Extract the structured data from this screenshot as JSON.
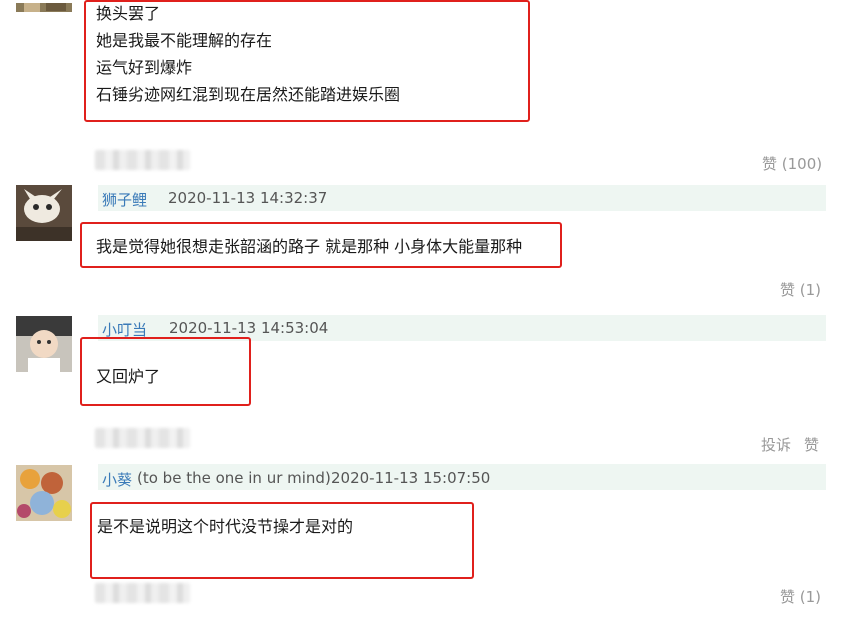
{
  "comment0": {
    "lines": [
      "换头罢了",
      "她是我最不能理解的存在",
      "运气好到爆炸",
      "石锤劣迹网红混到现在居然还能踏进娱乐圈"
    ],
    "likes": "赞 (100)"
  },
  "comment1": {
    "username": "狮子鲤",
    "timestamp": "2020-11-13 14:32:37",
    "text": "我是觉得她很想走张韶涵的路子 就是那种 小身体大能量那种",
    "likes": "赞 (1)"
  },
  "comment2": {
    "username": "小叮当",
    "timestamp": "2020-11-13 14:53:04",
    "text": "又回炉了",
    "report": "投诉",
    "likes": "赞"
  },
  "comment3": {
    "username": "小葵",
    "user_note": "(to be the one in ur mind)",
    "timestamp": "2020-11-13 15:07:50",
    "text": "是不是说明这个时代没节操才是对的",
    "likes": "赞 (1)"
  },
  "colors": {
    "highlight_border": "#e0201c",
    "username": "#3a7ab8",
    "header_bg": "#eef6f2"
  }
}
